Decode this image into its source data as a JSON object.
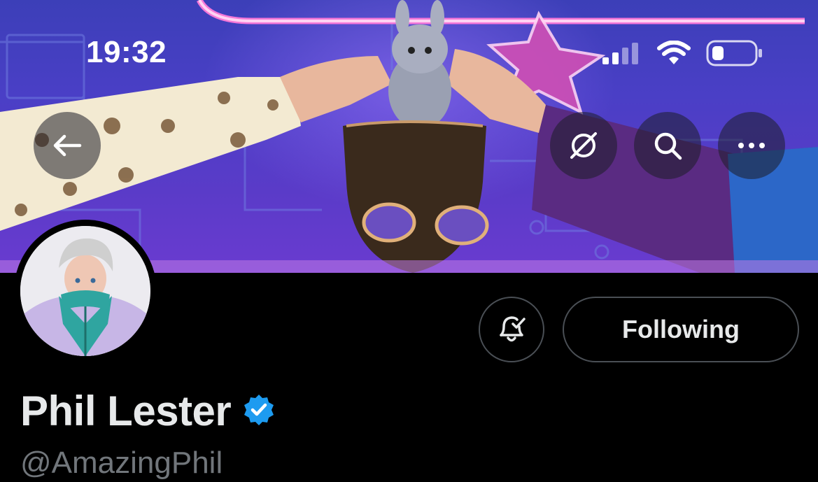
{
  "status_bar": {
    "time": "19:32",
    "signal_icon": "cellular-signal-icon",
    "wifi_icon": "wifi-icon",
    "battery_icon": "battery-low-icon"
  },
  "header_actions": {
    "back_icon": "back-arrow-icon",
    "translate_icon": "grok-slash-circle-icon",
    "search_icon": "search-icon",
    "more_icon": "more-horizontal-icon"
  },
  "profile": {
    "display_name": "Phil Lester",
    "handle": "@AmazingPhil",
    "verified": true,
    "verified_color": "#1d9bf0",
    "notifications_icon": "bell-check-icon",
    "follow_button_label": "Following"
  },
  "colors": {
    "background": "#000000",
    "primary_text": "#e7e9ea",
    "secondary_text": "#71767b",
    "border": "#4a4f55"
  }
}
